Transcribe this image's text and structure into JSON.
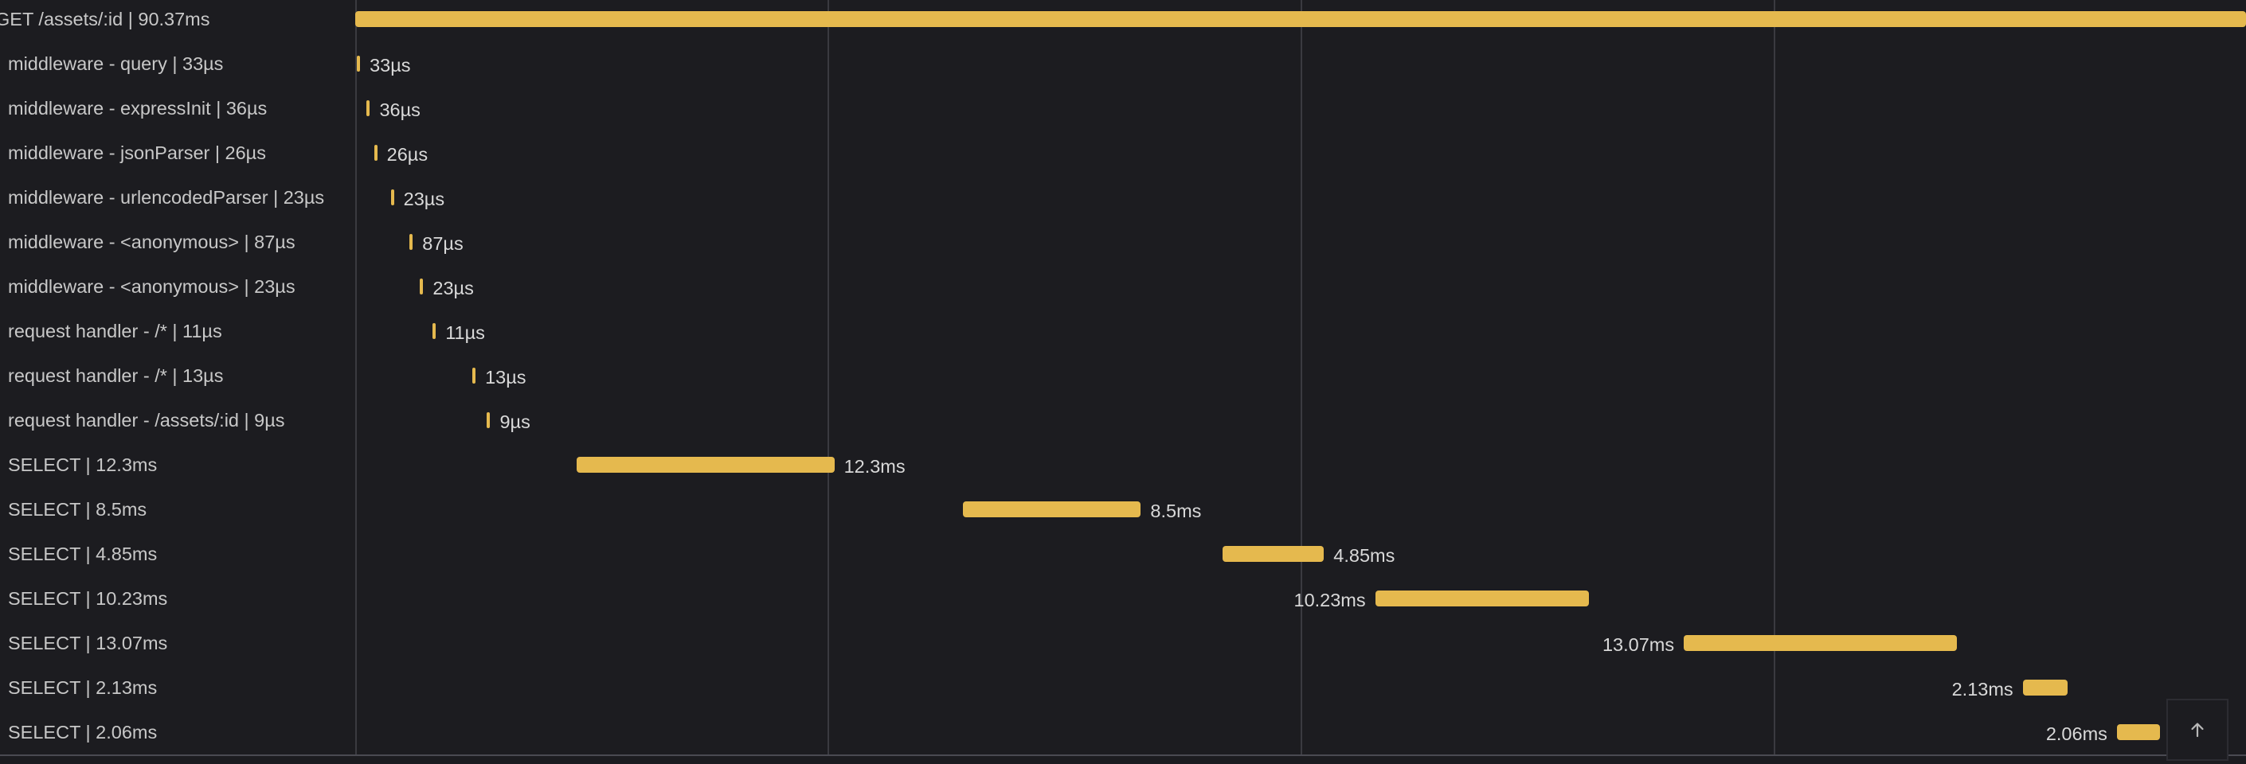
{
  "spans": [
    {
      "label": "GET /assets/:id | 90.37ms",
      "value": "90.37ms",
      "start_ms": 0,
      "duration_ms": 90.37,
      "root": true,
      "show_value": false
    },
    {
      "label": "middleware - query | 33µs",
      "value": "33µs",
      "start_ms": 0.08,
      "duration_ms": 0.033,
      "value_side": "right"
    },
    {
      "label": "middleware - expressInit | 36µs",
      "value": "36µs",
      "start_ms": 0.55,
      "duration_ms": 0.036,
      "value_side": "right"
    },
    {
      "label": "middleware - jsonParser | 26µs",
      "value": "26µs",
      "start_ms": 0.9,
      "duration_ms": 0.026,
      "value_side": "right"
    },
    {
      "label": "middleware - urlencodedParser | 23µs",
      "value": "23µs",
      "start_ms": 1.7,
      "duration_ms": 0.023,
      "value_side": "right"
    },
    {
      "label": "middleware - <anonymous> | 87µs",
      "value": "87µs",
      "start_ms": 2.6,
      "duration_ms": 0.087,
      "value_side": "right"
    },
    {
      "label": "middleware - <anonymous> | 23µs",
      "value": "23µs",
      "start_ms": 3.1,
      "duration_ms": 0.023,
      "value_side": "right"
    },
    {
      "label": "request handler - /* | 11µs",
      "value": "11µs",
      "start_ms": 3.7,
      "duration_ms": 0.011,
      "value_side": "right"
    },
    {
      "label": "request handler - /* | 13µs",
      "value": "13µs",
      "start_ms": 5.6,
      "duration_ms": 0.013,
      "value_side": "right"
    },
    {
      "label": "request handler - /assets/:id | 9µs",
      "value": "9µs",
      "start_ms": 6.3,
      "duration_ms": 0.009,
      "value_side": "right"
    },
    {
      "label": "SELECT | 12.3ms",
      "value": "12.3ms",
      "start_ms": 10.6,
      "duration_ms": 12.3,
      "value_side": "right"
    },
    {
      "label": "SELECT | 8.5ms",
      "value": "8.5ms",
      "start_ms": 29.05,
      "duration_ms": 8.5,
      "value_side": "right"
    },
    {
      "label": "SELECT | 4.85ms",
      "value": "4.85ms",
      "start_ms": 41.45,
      "duration_ms": 4.85,
      "value_side": "right"
    },
    {
      "label": "SELECT | 10.23ms",
      "value": "10.23ms",
      "start_ms": 48.75,
      "duration_ms": 10.23,
      "value_side": "left"
    },
    {
      "label": "SELECT | 13.07ms",
      "value": "13.07ms",
      "start_ms": 63.5,
      "duration_ms": 13.07,
      "value_side": "left"
    },
    {
      "label": "SELECT | 2.13ms",
      "value": "2.13ms",
      "start_ms": 79.7,
      "duration_ms": 2.13,
      "value_side": "left"
    },
    {
      "label": "SELECT | 2.06ms",
      "value": "2.06ms",
      "start_ms": 84.2,
      "duration_ms": 2.06,
      "value_side": "left"
    }
  ],
  "total_duration_ms": 90.37,
  "gridline_ms": [
    0,
    22.59,
    45.18,
    67.78
  ],
  "bar_color": "#e5b94e",
  "scroll_top_icon": "arrow-up-icon"
}
